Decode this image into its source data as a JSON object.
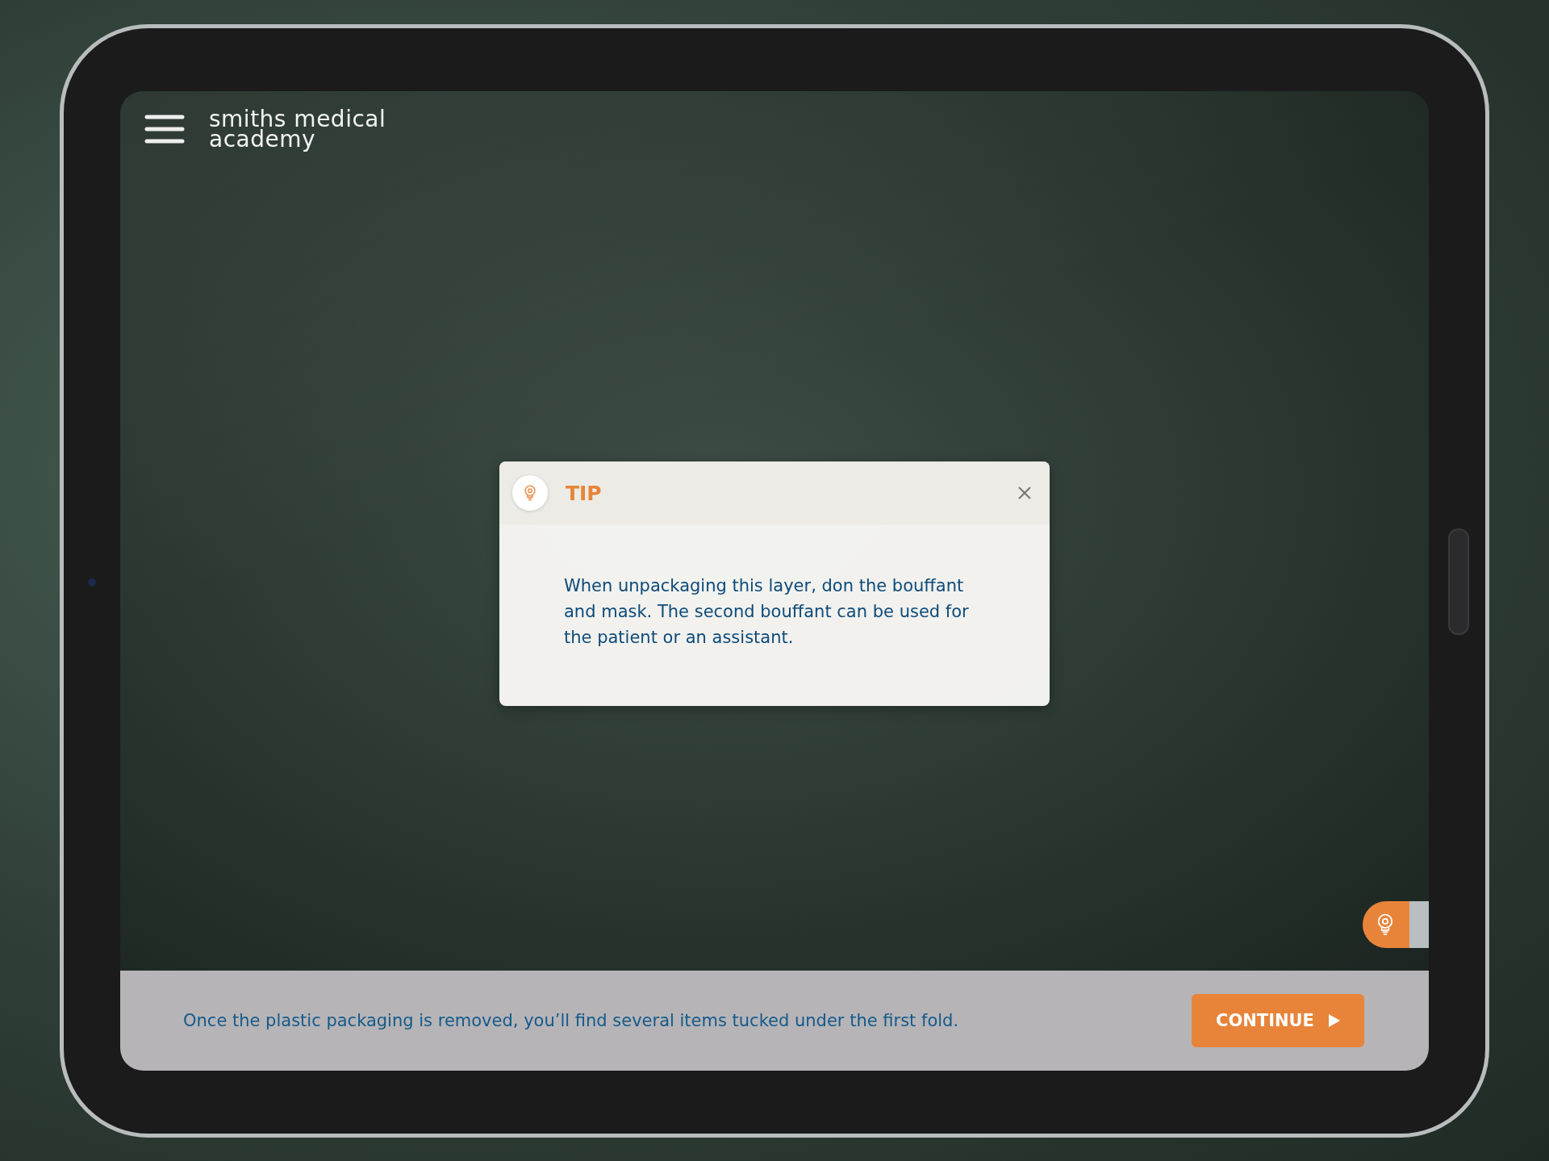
{
  "header": {
    "logo_lines": [
      "smiths medical",
      "academy"
    ]
  },
  "tip": {
    "title": "TIP",
    "body": "When unpackaging this layer, don the bouffant and mask. The second bouffant can be used for the patient or an assistant."
  },
  "bottom_bar": {
    "instruction": "Once the plastic packaging is removed, you’ll find several items tucked under the first fold.",
    "continue_label": "CONTINUE"
  }
}
